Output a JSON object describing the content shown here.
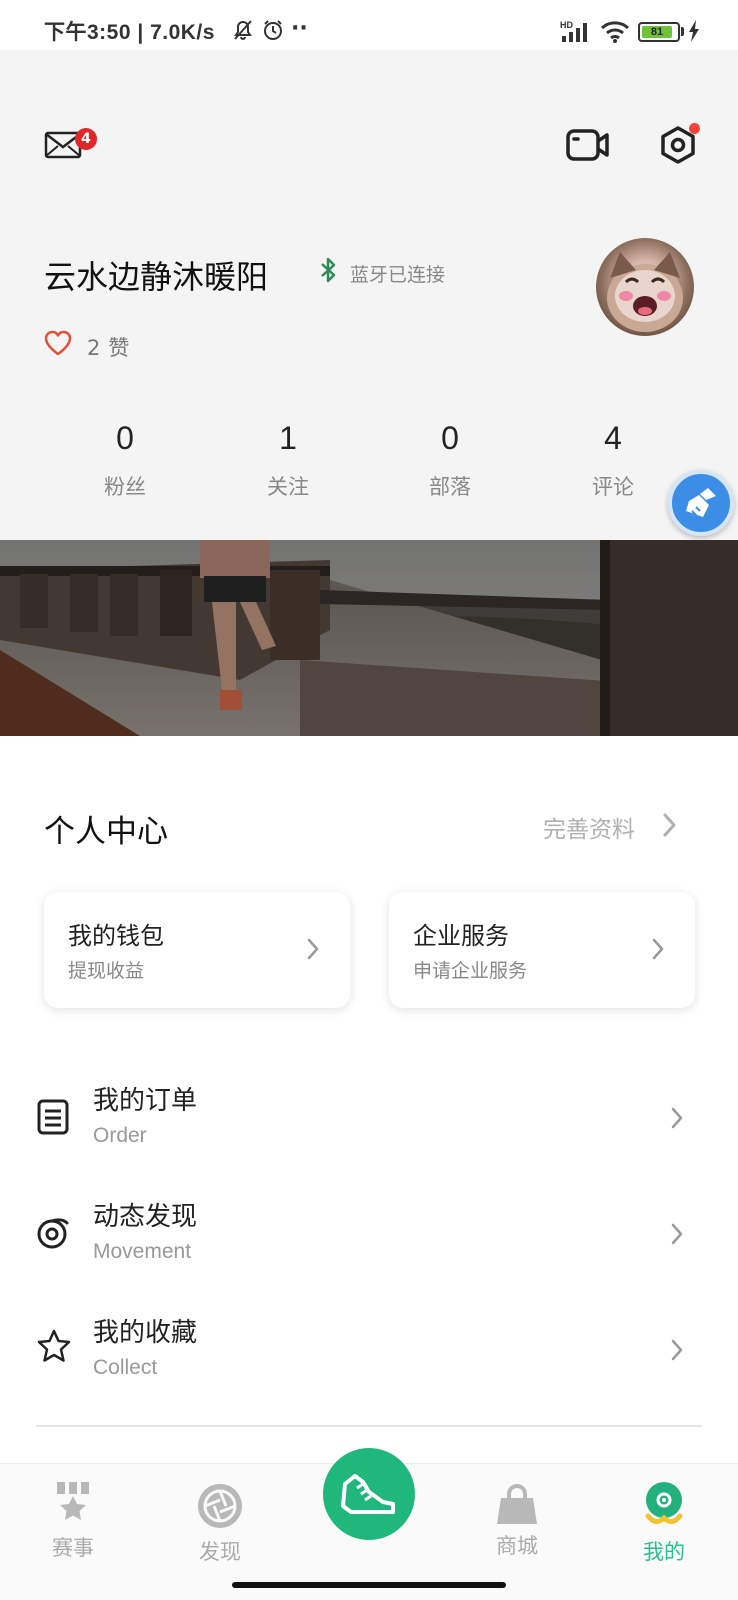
{
  "status_bar": {
    "time_speed": "下午3:50 | 7.0K/s",
    "network": "HD",
    "battery": "81",
    "battery_level": 0.81
  },
  "header": {
    "mail_badge": "4",
    "username": "云水边静沐暖阳",
    "bluetooth_status": "蓝牙已连接",
    "likes_count": "2",
    "likes_unit": "赞",
    "stats": [
      {
        "value": "0",
        "label": "粉丝"
      },
      {
        "value": "1",
        "label": "关注"
      },
      {
        "value": "0",
        "label": "部落"
      },
      {
        "value": "4",
        "label": "评论"
      }
    ]
  },
  "personal_center": {
    "title": "个人中心",
    "complete_profile": "完善资料",
    "cards": [
      {
        "title": "我的钱包",
        "subtitle": "提现收益"
      },
      {
        "title": "企业服务",
        "subtitle": "申请企业服务"
      }
    ],
    "menu": [
      {
        "title": "我的订单",
        "subtitle": "Order",
        "icon": "document-icon"
      },
      {
        "title": "动态发现",
        "subtitle": "Movement",
        "icon": "discover-icon"
      },
      {
        "title": "我的收藏",
        "subtitle": "Collect",
        "icon": "star-icon"
      }
    ]
  },
  "bottom_nav": {
    "items": [
      {
        "label": "赛事",
        "icon": "trophy-icon"
      },
      {
        "label": "发现",
        "icon": "aperture-icon"
      },
      {
        "label": "",
        "icon": "running-shoe-icon"
      },
      {
        "label": "商城",
        "icon": "shopping-bag-icon"
      },
      {
        "label": "我的",
        "icon": "profile-icon"
      }
    ],
    "active_index": 4
  },
  "colors": {
    "accent": "#1fb77c",
    "active_tab": "#2bbf8c",
    "badge": "#e0282b",
    "bluetooth": "#2f8a56"
  }
}
